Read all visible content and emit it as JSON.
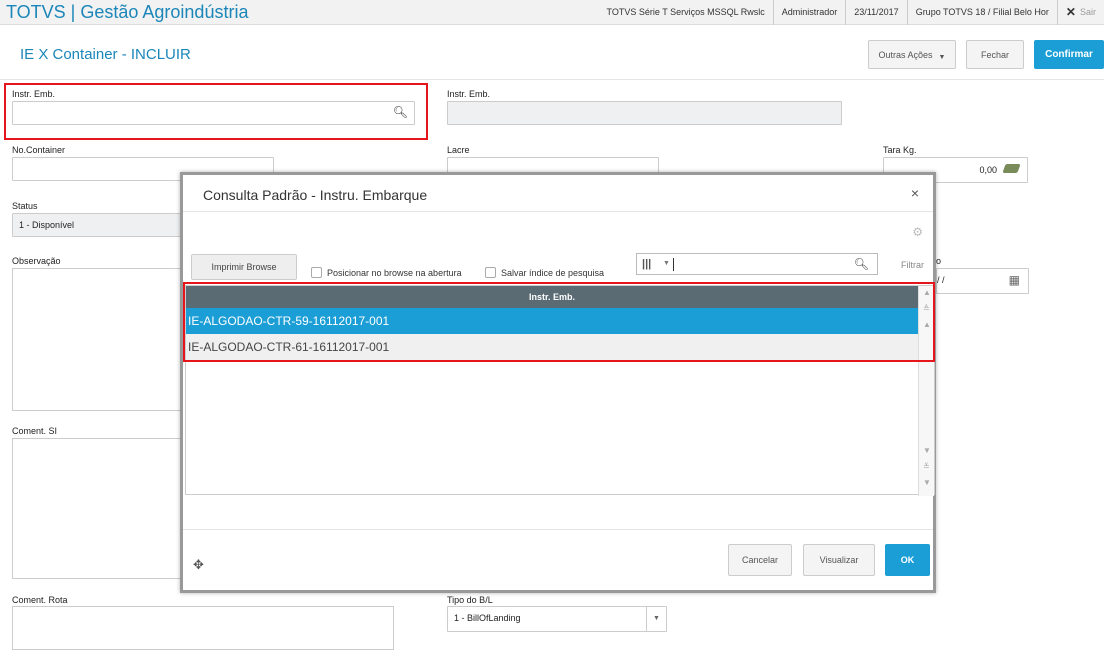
{
  "topbar": {
    "app_title": "TOTVS | Gestão Agroindústria",
    "server": "TOTVS Série T Serviços MSSQL Rwslc",
    "user": "Administrador",
    "date": "23/11/2017",
    "branch": "Grupo TOTVS 18 / Filial Belo Hor",
    "exit": "Sair"
  },
  "header": {
    "title": "IE X Container - INCLUIR",
    "more_actions": "Outras Ações",
    "close": "Fechar",
    "confirm": "Confirmar"
  },
  "form": {
    "instr_emb_label": "Instr. Emb.",
    "instr_emb_value": "",
    "instr_emb_desc_label": "Instr. Emb.",
    "container_label": "No.Container",
    "lacre_label": "Lacre",
    "tara_label": "Tara Kg.",
    "tara_value": "0,00",
    "status_label": "Status",
    "status_value": "1 - Disponível",
    "obs_label": "Observação",
    "date_fragment": "/ /",
    "date_label_fragment": "o",
    "coment_si_label": "Coment. SI",
    "coment_rota_label": "Coment. Rota",
    "tipo_bl_label": "Tipo do B/L",
    "tipo_bl_value": "1 - BillOfLanding"
  },
  "modal": {
    "title": "Consulta Padrão - Instru. Embarque",
    "print_browse": "Imprimir Browse",
    "position_check": "Posicionar no browse na abertura",
    "save_index_check": "Salvar índice de pesquisa",
    "search_value": "",
    "filter": "Filtrar",
    "grid_header": "Instr. Emb.",
    "rows": [
      "IE-ALGODAO-CTR-59-16112017-001",
      "IE-ALGODAO-CTR-61-16112017-001"
    ],
    "cancel": "Cancelar",
    "view": "Visualizar",
    "ok": "OK"
  }
}
